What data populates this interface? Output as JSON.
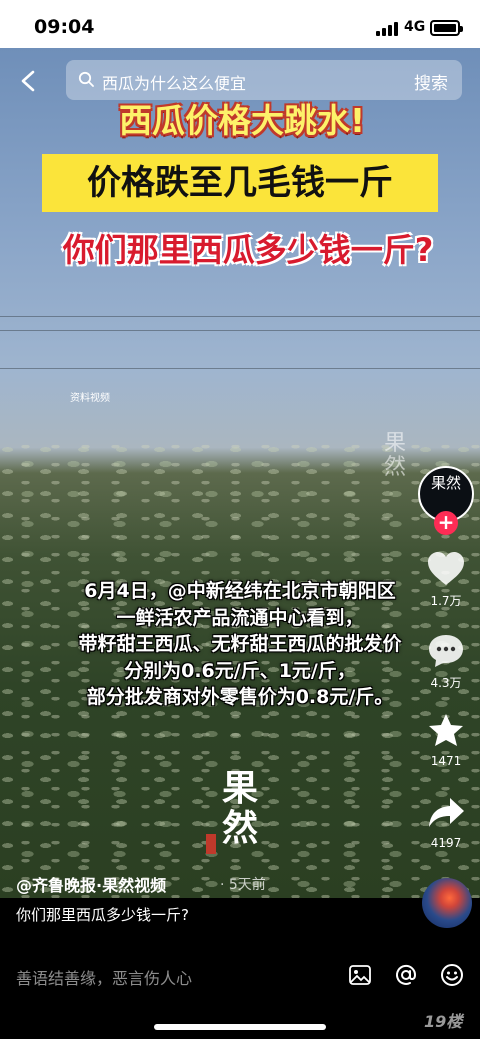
{
  "status_bar": {
    "time": "09:04",
    "network": "4G"
  },
  "search": {
    "query": "西瓜为什么这么便宜",
    "button_label": "搜索"
  },
  "video": {
    "headline_1": "西瓜价格大跳水!",
    "headline_2": "价格跌至几毛钱一斤",
    "headline_3": "你们那里西瓜多少钱一斤?",
    "source_label": "资料视频",
    "subtitle_lines": [
      "6月4日，@中新经纬在北京市朝阳区",
      "一鲜活农产品流通中心看到，",
      "带籽甜王西瓜、无籽甜王西瓜的批发价",
      "分别为0.6元/斤、1元/斤，",
      "部分批发商对外零售价为0.8元/斤。"
    ],
    "watermark": "果然"
  },
  "sidebar": {
    "avatar_text": "果然",
    "follow_label": "+",
    "like_count": "1.7万",
    "comment_count": "4.3万",
    "favorite_count": "1471",
    "share_count": "4197"
  },
  "post": {
    "author": "@齐鲁晚报·果然视频",
    "time_ago": "· 5天前",
    "caption": "你们那里西瓜多少钱一斤?"
  },
  "comment_bar": {
    "placeholder": "善语结善缘，恶言伤人心"
  },
  "site_mark": "19楼"
}
